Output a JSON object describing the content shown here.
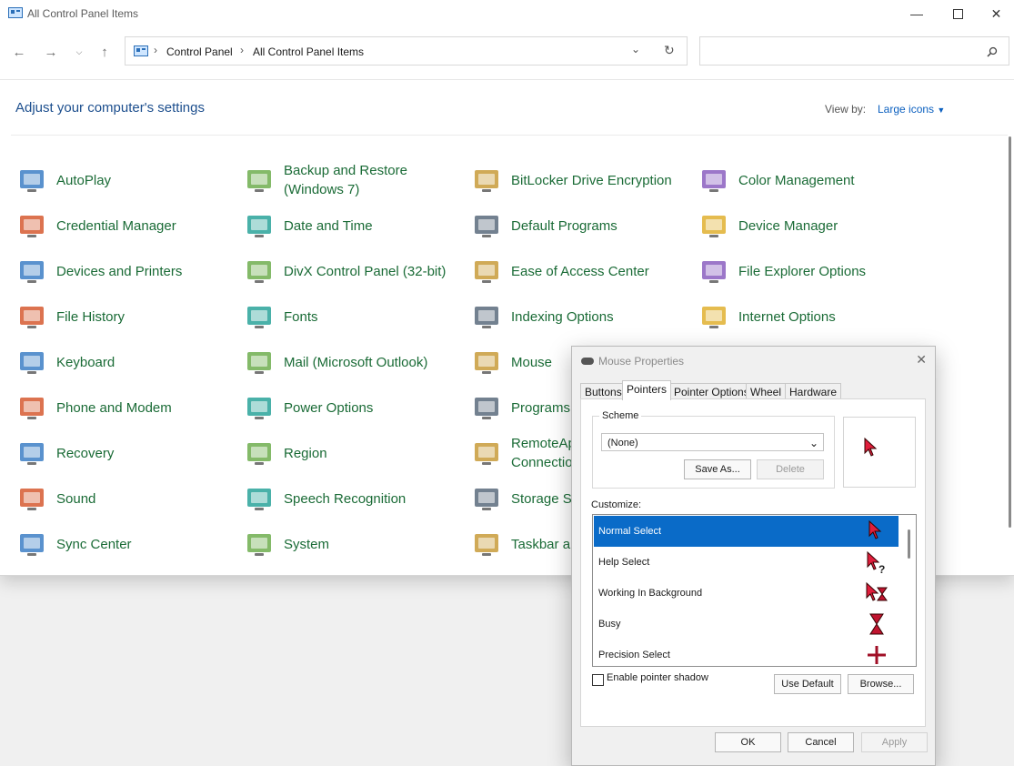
{
  "window": {
    "title": "All Control Panel Items"
  },
  "breadcrumb": {
    "root": "Control Panel",
    "current": "All Control Panel Items"
  },
  "header": {
    "heading": "Adjust your computer's settings",
    "view_by_label": "View by:",
    "view_by_value": "Large icons"
  },
  "items": [
    {
      "label": "AutoPlay",
      "icon": "autoplay-icon"
    },
    {
      "label": "Backup and Restore (Windows 7)",
      "icon": "backup-icon"
    },
    {
      "label": "BitLocker Drive Encryption",
      "icon": "bitlocker-icon"
    },
    {
      "label": "Color Management",
      "icon": "color-management-icon"
    },
    {
      "label": "Credential Manager",
      "icon": "credential-icon"
    },
    {
      "label": "Date and Time",
      "icon": "clock-icon"
    },
    {
      "label": "Default Programs",
      "icon": "default-programs-icon"
    },
    {
      "label": "Device Manager",
      "icon": "device-manager-icon"
    },
    {
      "label": "Devices and Printers",
      "icon": "printer-icon"
    },
    {
      "label": "DivX Control Panel (32-bit)",
      "icon": "divx-icon"
    },
    {
      "label": "Ease of Access Center",
      "icon": "ease-of-access-icon"
    },
    {
      "label": "File Explorer Options",
      "icon": "folder-options-icon"
    },
    {
      "label": "File History",
      "icon": "file-history-icon"
    },
    {
      "label": "Fonts",
      "icon": "fonts-icon"
    },
    {
      "label": "Indexing Options",
      "icon": "indexing-icon"
    },
    {
      "label": "Internet Options",
      "icon": "internet-icon"
    },
    {
      "label": "Keyboard",
      "icon": "keyboard-icon"
    },
    {
      "label": "Mail (Microsoft Outlook)",
      "icon": "mail-icon"
    },
    {
      "label": "Mouse",
      "icon": "mouse-icon"
    },
    {
      "label": "",
      "icon": ""
    },
    {
      "label": "Phone and Modem",
      "icon": "phone-icon"
    },
    {
      "label": "Power Options",
      "icon": "power-icon"
    },
    {
      "label": "Programs",
      "icon": "programs-icon"
    },
    {
      "label": "",
      "icon": ""
    },
    {
      "label": "Recovery",
      "icon": "recovery-icon"
    },
    {
      "label": "Region",
      "icon": "region-icon"
    },
    {
      "label": "RemoteAp Connectio",
      "icon": "remoteapp-icon"
    },
    {
      "label": "",
      "icon": ""
    },
    {
      "label": "Sound",
      "icon": "speaker-icon"
    },
    {
      "label": "Speech Recognition",
      "icon": "microphone-icon"
    },
    {
      "label": "Storage S",
      "icon": "storage-icon"
    },
    {
      "label": "",
      "icon": ""
    },
    {
      "label": "Sync Center",
      "icon": "sync-icon"
    },
    {
      "label": "System",
      "icon": "system-icon"
    },
    {
      "label": "Taskbar ar",
      "icon": "taskbar-icon"
    },
    {
      "label": "",
      "icon": ""
    }
  ],
  "dialog": {
    "title": "Mouse Properties",
    "tabs": [
      "Buttons",
      "Pointers",
      "Pointer Options",
      "Wheel",
      "Hardware"
    ],
    "active_tab": "Pointers",
    "scheme_label": "Scheme",
    "scheme_value": "(None)",
    "save_as": "Save As...",
    "delete": "Delete",
    "customize_label": "Customize:",
    "pointers": [
      "Normal Select",
      "Help Select",
      "Working In Background",
      "Busy",
      "Precision Select"
    ],
    "shadow_label": "Enable pointer shadow",
    "use_default": "Use Default",
    "browse": "Browse...",
    "ok": "OK",
    "cancel": "Cancel",
    "apply": "Apply"
  }
}
